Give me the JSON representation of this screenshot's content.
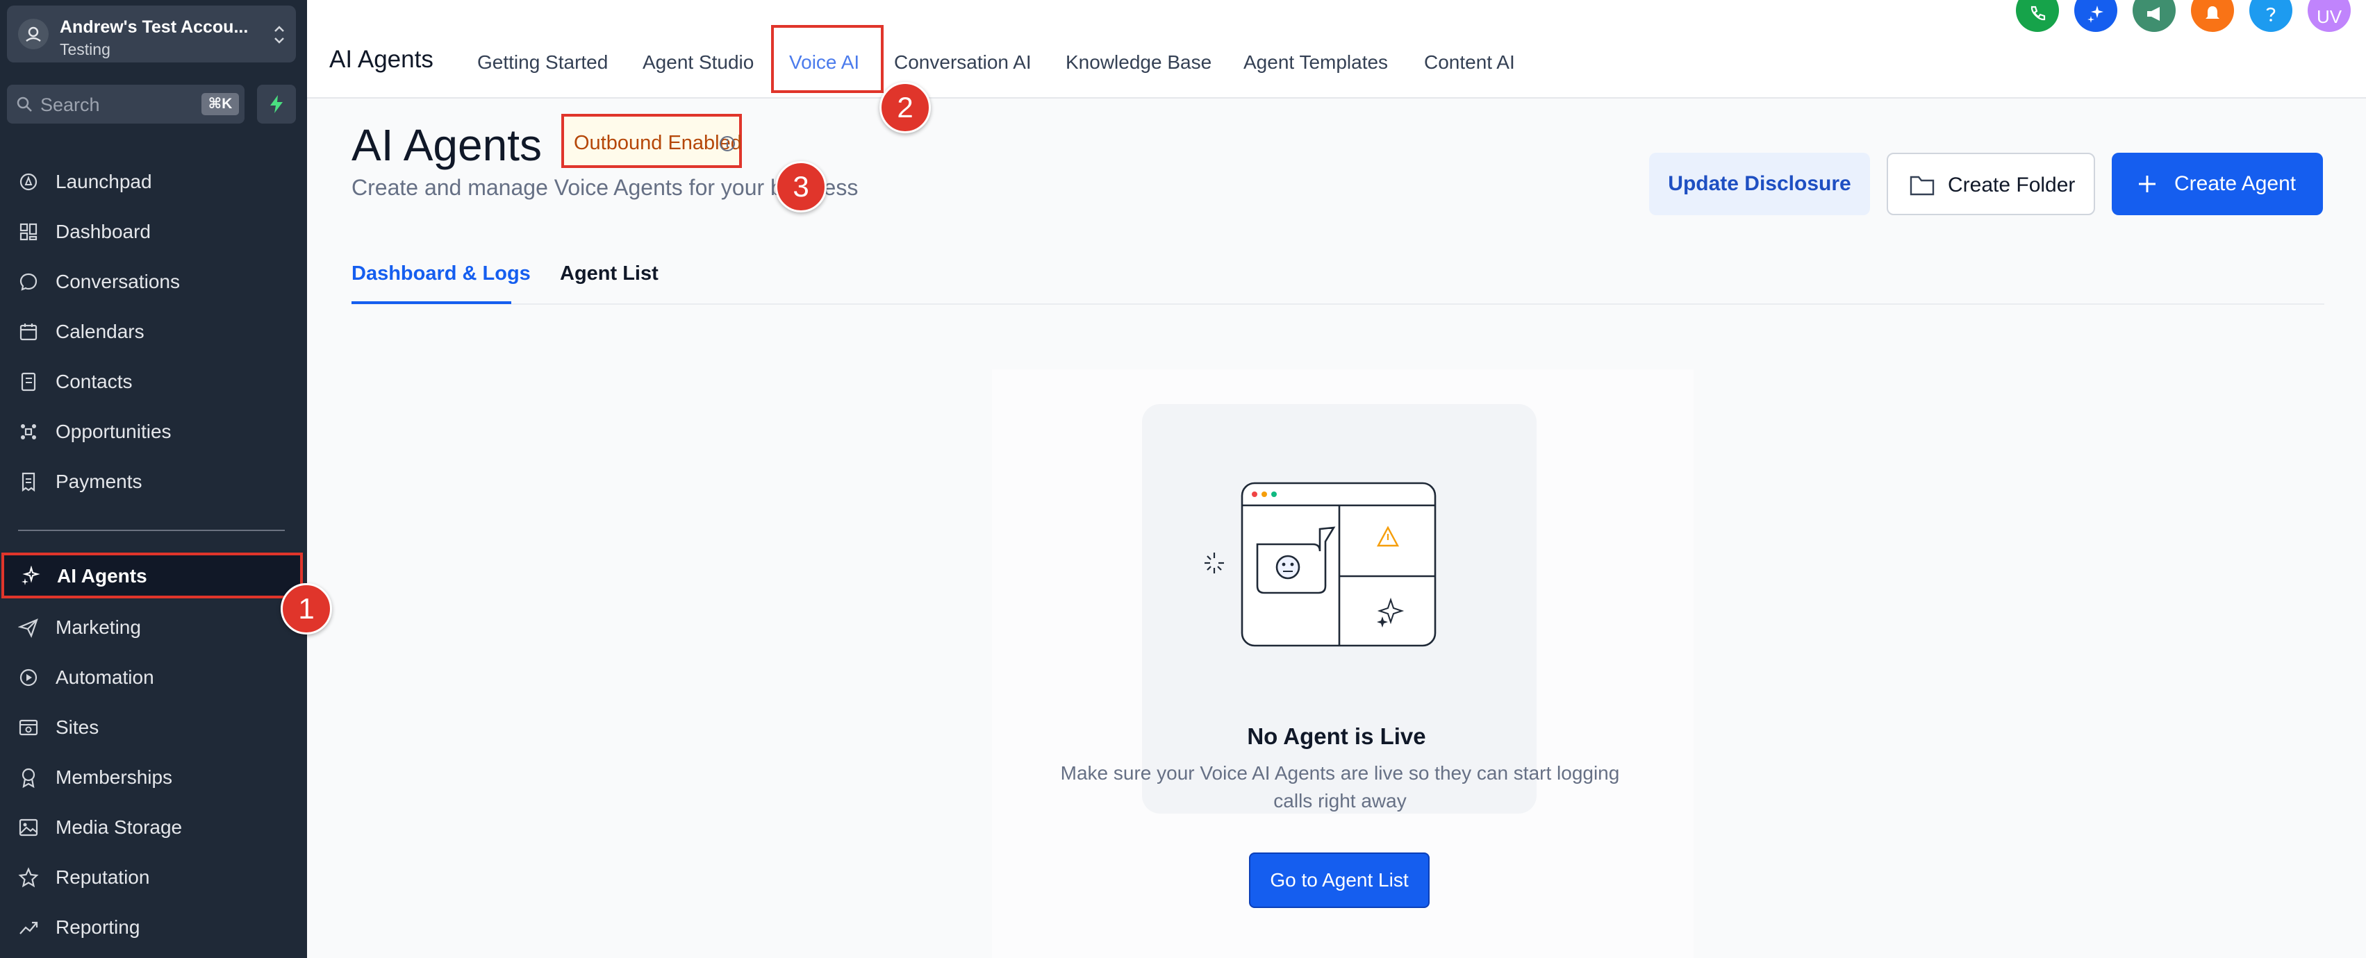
{
  "account": {
    "name": "Andrew's Test Accou...",
    "subtitle": "Testing"
  },
  "search": {
    "placeholder": "Search",
    "shortcut": "⌘K"
  },
  "sidebar": {
    "items": [
      {
        "label": "Launchpad"
      },
      {
        "label": "Dashboard"
      },
      {
        "label": "Conversations"
      },
      {
        "label": "Calendars"
      },
      {
        "label": "Contacts"
      },
      {
        "label": "Opportunities"
      },
      {
        "label": "Payments"
      },
      {
        "label": "AI Agents"
      },
      {
        "label": "Marketing"
      },
      {
        "label": "Automation"
      },
      {
        "label": "Sites"
      },
      {
        "label": "Memberships"
      },
      {
        "label": "Media Storage"
      },
      {
        "label": "Reputation"
      },
      {
        "label": "Reporting"
      }
    ]
  },
  "topnav": {
    "brand": "AI Agents",
    "tabs": [
      {
        "label": "Getting Started"
      },
      {
        "label": "Agent Studio"
      },
      {
        "label": "Voice AI"
      },
      {
        "label": "Conversation AI"
      },
      {
        "label": "Knowledge Base"
      },
      {
        "label": "Agent Templates"
      },
      {
        "label": "Content AI"
      }
    ],
    "user_initials": "UV"
  },
  "page": {
    "title": "AI Agents",
    "badge": "Outbound Enabled",
    "subtitle": "Create and manage Voice Agents for your business",
    "buttons": {
      "disclosure": "Update Disclosure",
      "folder": "Create Folder",
      "agent": "Create Agent"
    },
    "subtabs": [
      {
        "label": "Dashboard & Logs"
      },
      {
        "label": "Agent List"
      }
    ]
  },
  "empty_state": {
    "title": "No Agent is Live",
    "description": "Make sure your Voice AI Agents are live so they can start logging calls right away",
    "button": "Go to Agent List"
  },
  "callouts": [
    "1",
    "2",
    "3"
  ],
  "colors": {
    "accent": "#155eef",
    "highlight": "#e0352b",
    "sidebar": "#1f2937",
    "badge_text": "#b54708"
  }
}
